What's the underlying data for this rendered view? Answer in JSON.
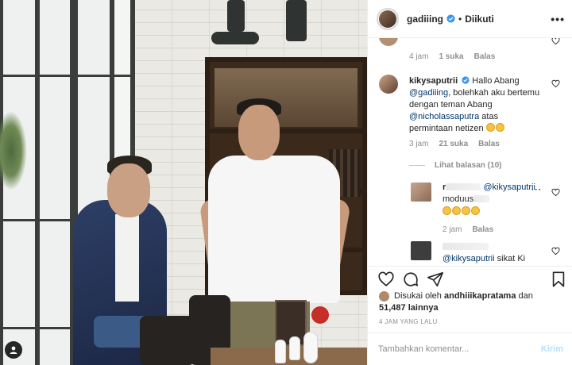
{
  "header": {
    "username": "gadiiing",
    "separator": "•",
    "follow_status": "Diikuti",
    "more": "•••"
  },
  "comments": [
    {
      "meta_time": "4 jam",
      "meta_likes": "1 suka",
      "meta_reply": "Balas"
    },
    {
      "username": "kikysaputrii",
      "text_1": "Hallo Abang",
      "mention_1": "@gadiiing",
      "text_2": ", bolehkah aku bertemu dengan teman Abang",
      "mention_2": "@nicholassaputra",
      "text_3": "atas permintaan netizen",
      "meta_time": "3 jam",
      "meta_likes": "21 suka",
      "meta_reply": "Balas",
      "view_replies": "Lihat balasan (10)"
    }
  ],
  "replies": [
    {
      "username_visible": "r",
      "mention": "@kikysaputrii",
      "text": "moduus",
      "meta_time": "2 jam",
      "meta_reply": "Balas"
    },
    {
      "mention": "@kikysaputrii",
      "text": "sikat Ki"
    }
  ],
  "likes": {
    "prefix": "Disukai oleh",
    "user": "andhiiikapratama",
    "joiner": "dan",
    "count": "51,487",
    "suffix": "lainnya"
  },
  "timestamp": "4 JAM YANG LALU",
  "composer": {
    "placeholder": "Tambahkan komentar...",
    "post_label": "Kirim"
  },
  "icons": {
    "verified": "verified-badge-icon",
    "like": "heart-icon",
    "comment": "comment-icon",
    "share": "paper-plane-icon",
    "save": "bookmark-icon",
    "tag": "user-tag-icon"
  },
  "colors": {
    "verified": "#3897f0",
    "mention": "#00376b",
    "post_button_disabled": "#b2dffc",
    "meta_text": "#8e8e8e"
  }
}
